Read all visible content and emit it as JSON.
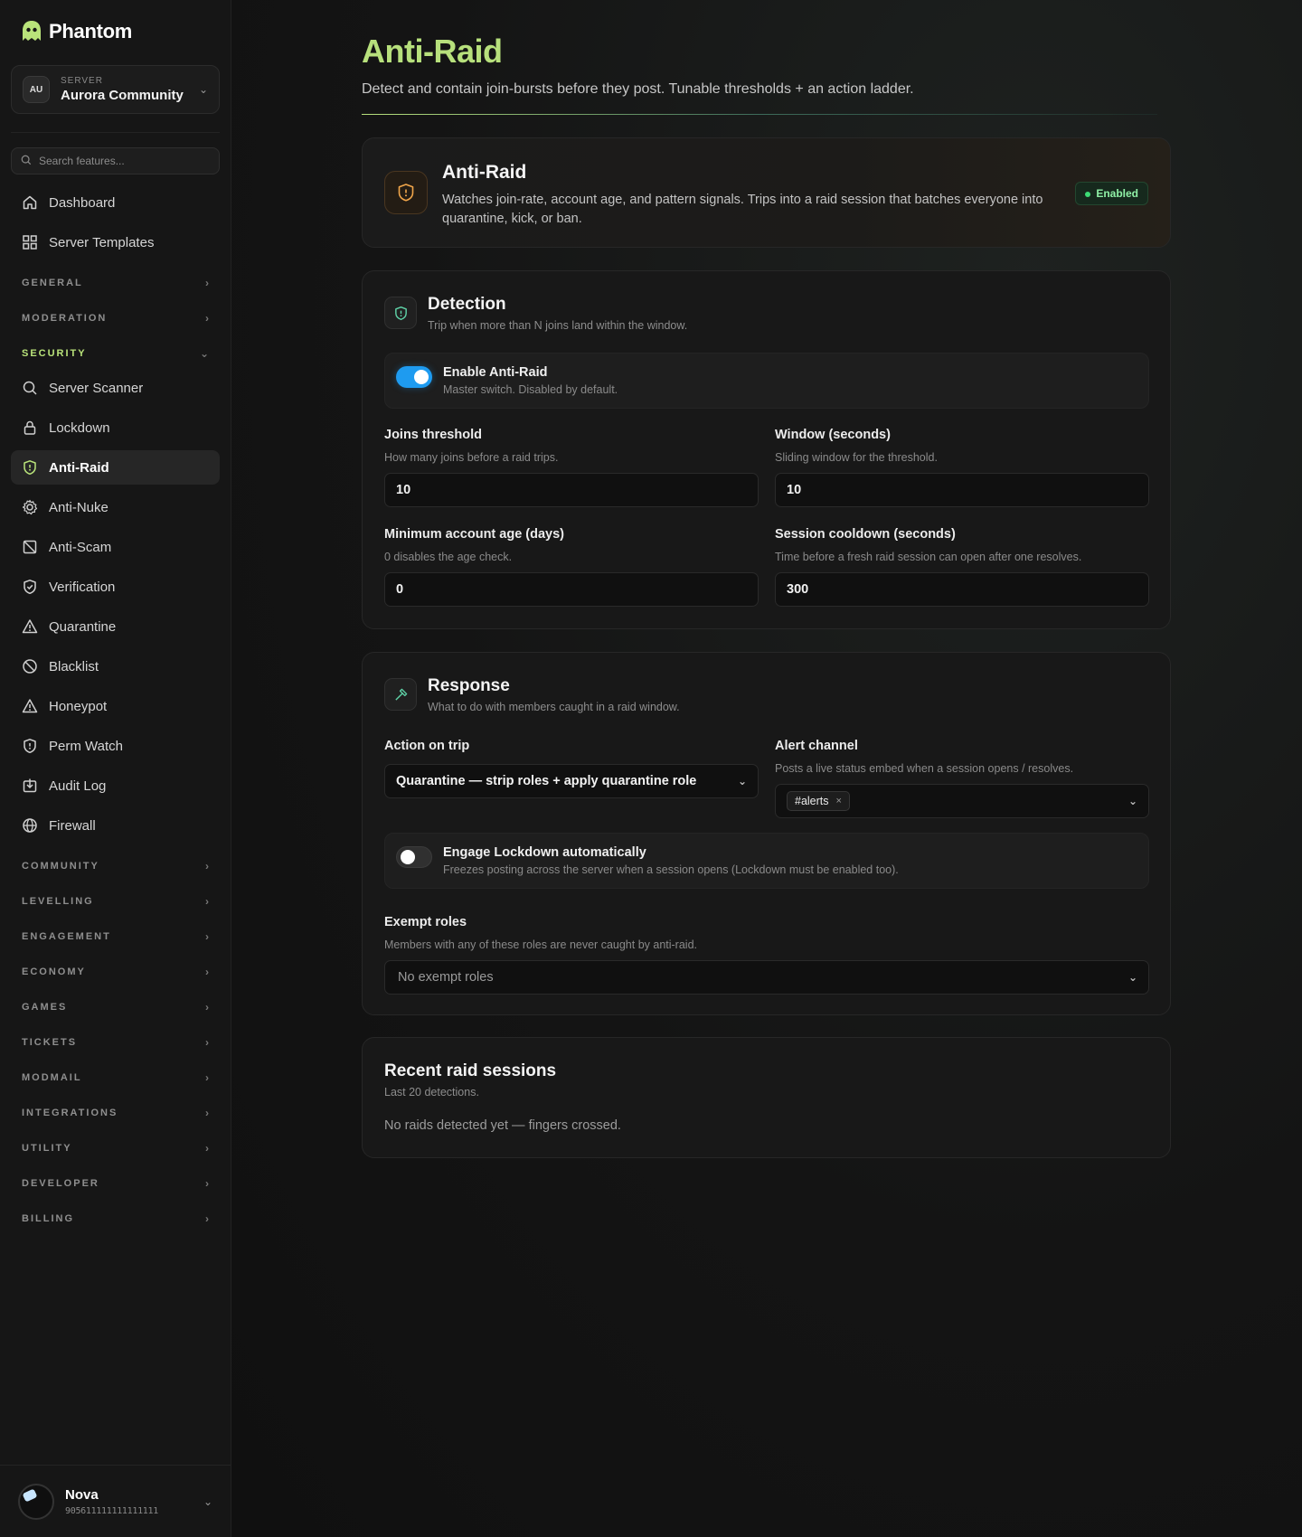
{
  "brand": {
    "name": "Phantom"
  },
  "server": {
    "label": "SERVER",
    "initials": "AU",
    "name": "Aurora Community"
  },
  "search": {
    "placeholder": "Search features..."
  },
  "nav_top": [
    {
      "label": "Dashboard",
      "icon": "home-icon"
    },
    {
      "label": "Server Templates",
      "icon": "grid-icon"
    }
  ],
  "sections_before": [
    {
      "label": "GENERAL"
    },
    {
      "label": "MODERATION"
    }
  ],
  "security": {
    "label": "SECURITY",
    "items": [
      {
        "label": "Server Scanner",
        "icon": "search-icon"
      },
      {
        "label": "Lockdown",
        "icon": "lock-icon"
      },
      {
        "label": "Anti-Raid",
        "icon": "shield-alert-icon"
      },
      {
        "label": "Anti-Nuke",
        "icon": "gear-icon"
      },
      {
        "label": "Anti-Scam",
        "icon": "scam-icon"
      },
      {
        "label": "Verification",
        "icon": "shield-check-icon"
      },
      {
        "label": "Quarantine",
        "icon": "warning-icon"
      },
      {
        "label": "Blacklist",
        "icon": "ban-icon"
      },
      {
        "label": "Honeypot",
        "icon": "warning-icon"
      },
      {
        "label": "Perm Watch",
        "icon": "shield-alert-icon"
      },
      {
        "label": "Audit Log",
        "icon": "download-box-icon"
      },
      {
        "label": "Firewall",
        "icon": "globe-icon"
      }
    ]
  },
  "sections_after": [
    {
      "label": "COMMUNITY"
    },
    {
      "label": "LEVELLING"
    },
    {
      "label": "ENGAGEMENT"
    },
    {
      "label": "ECONOMY"
    },
    {
      "label": "GAMES"
    },
    {
      "label": "TICKETS"
    },
    {
      "label": "MODMAIL"
    },
    {
      "label": "INTEGRATIONS"
    },
    {
      "label": "UTILITY"
    },
    {
      "label": "DEVELOPER"
    },
    {
      "label": "BILLING"
    }
  ],
  "user": {
    "name": "Nova",
    "id": "905611111111111111"
  },
  "page": {
    "title": "Anti-Raid",
    "subtitle": "Detect and contain join-bursts before they post. Tunable thresholds + an action ladder."
  },
  "hero": {
    "title": "Anti-Raid",
    "description": "Watches join-rate, account age, and pattern signals. Trips into a raid session that batches everyone into quarantine, kick, or ban.",
    "status": "Enabled"
  },
  "detection": {
    "title": "Detection",
    "subtitle": "Trip when more than N joins land within the window.",
    "enable": {
      "label": "Enable Anti-Raid",
      "sub": "Master switch. Disabled by default.",
      "on": true
    },
    "joins_threshold": {
      "label": "Joins threshold",
      "sub": "How many joins before a raid trips.",
      "value": "10"
    },
    "window": {
      "label": "Window (seconds)",
      "sub": "Sliding window for the threshold.",
      "value": "10"
    },
    "min_age": {
      "label": "Minimum account age (days)",
      "sub": "0 disables the age check.",
      "value": "0"
    },
    "cooldown": {
      "label": "Session cooldown (seconds)",
      "sub": "Time before a fresh raid session can open after one resolves.",
      "value": "300"
    }
  },
  "response": {
    "title": "Response",
    "subtitle": "What to do with members caught in a raid window.",
    "action": {
      "label": "Action on trip",
      "value": "Quarantine — strip roles + apply quarantine role"
    },
    "alert": {
      "label": "Alert channel",
      "sub": "Posts a live status embed when a session opens / resolves.",
      "chip": "#alerts",
      "chip_remove": "×"
    },
    "lockdown": {
      "label": "Engage Lockdown automatically",
      "sub": "Freezes posting across the server when a session opens (Lockdown must be enabled too).",
      "on": false
    },
    "exempt": {
      "label": "Exempt roles",
      "sub": "Members with any of these roles are never caught by anti-raid.",
      "placeholder": "No exempt roles"
    }
  },
  "recent": {
    "title": "Recent raid sessions",
    "subtitle": "Last 20 detections.",
    "empty": "No raids detected yet — fingers crossed."
  }
}
